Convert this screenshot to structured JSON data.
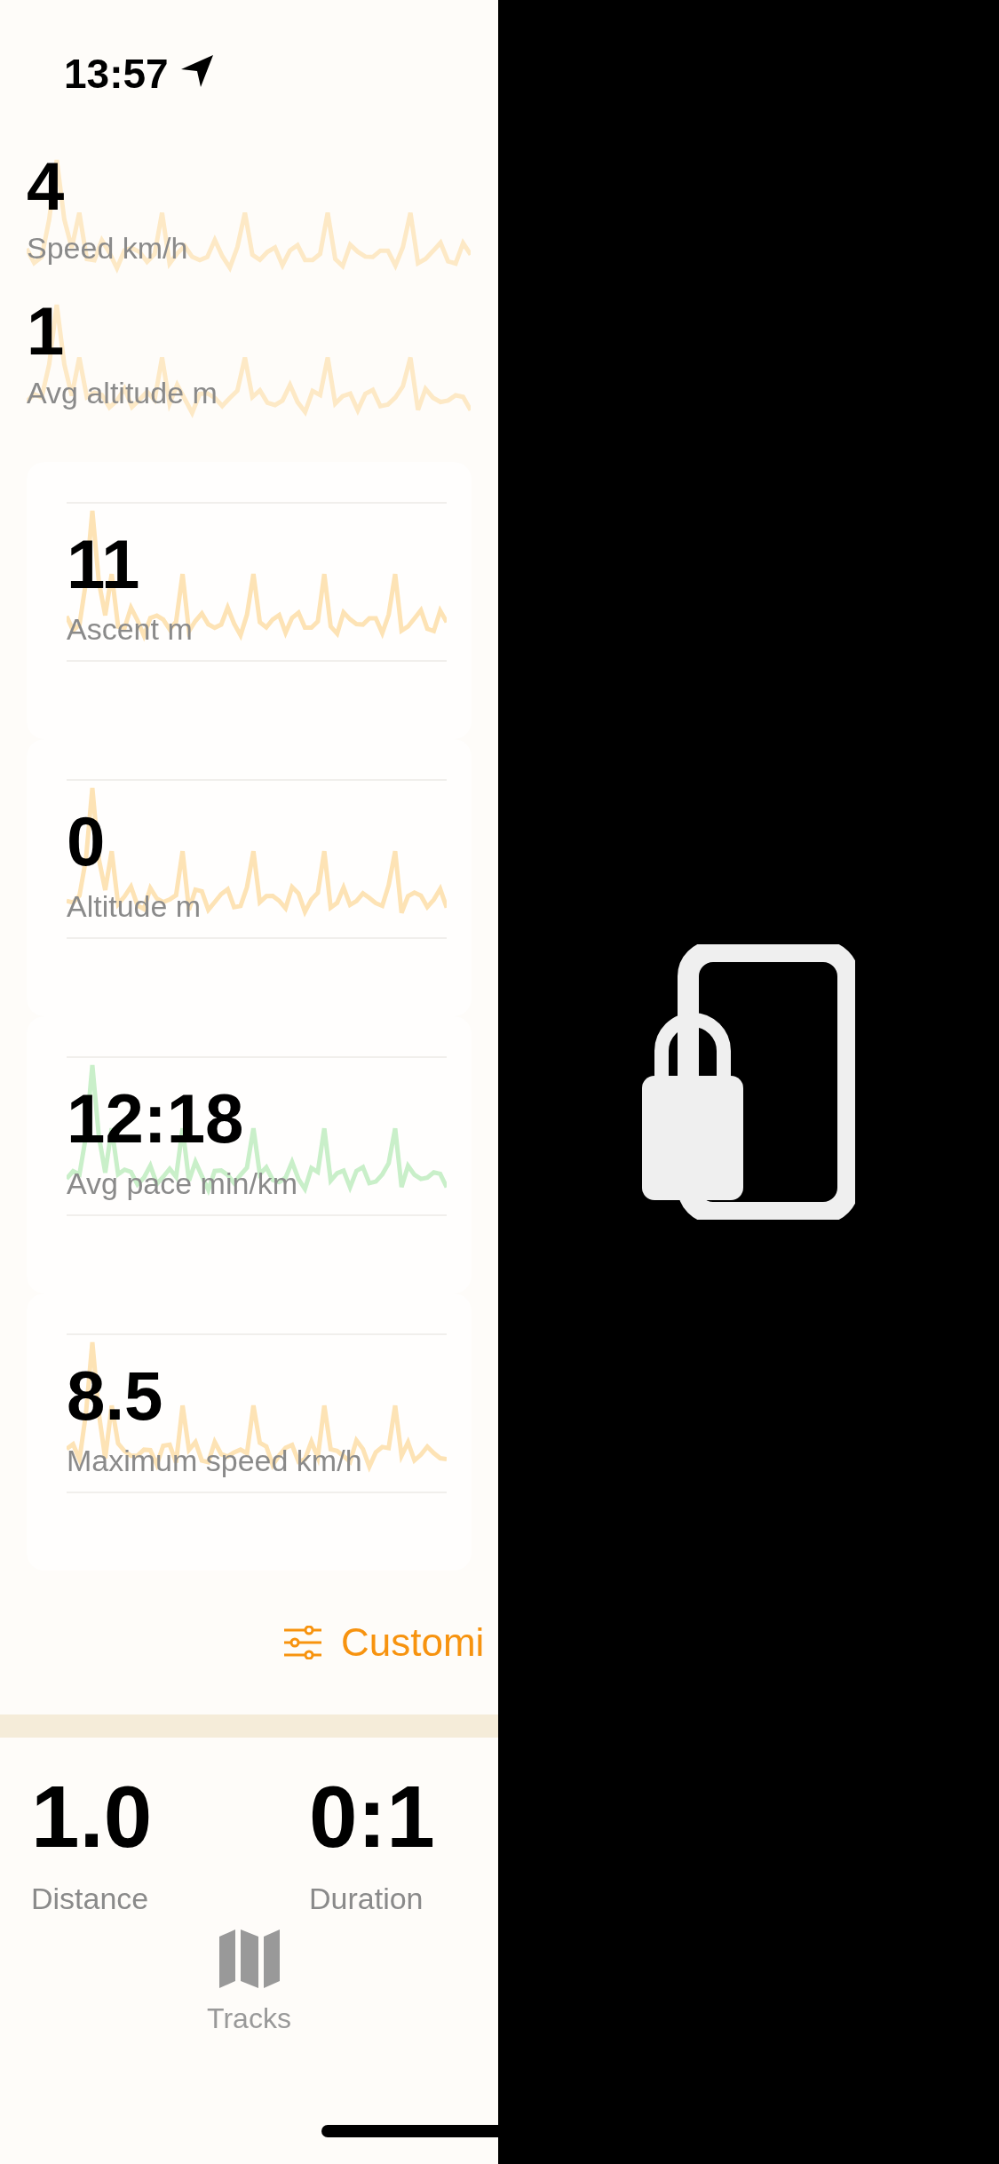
{
  "status_bar": {
    "time": "13:57"
  },
  "top_metrics": [
    {
      "value": "4",
      "label": "Speed km/h"
    },
    {
      "value": "1",
      "label": "Avg altitude m"
    }
  ],
  "cards": [
    {
      "value": "11",
      "label": "Ascent m",
      "color": "#fde3b5"
    },
    {
      "value": "0",
      "label": "Altitude m",
      "color": "#fde3b5"
    },
    {
      "value": "12:18",
      "label": "Avg pace min/km",
      "color": "#c9efc9"
    },
    {
      "value": "8.5",
      "label": "Maximum speed km/h",
      "color": "#fde3b5"
    }
  ],
  "customize_button": {
    "label": "Customi"
  },
  "summary": [
    {
      "value": "1.0",
      "label": "Distance"
    },
    {
      "value": "0:1",
      "label": "Duration"
    }
  ],
  "tab_bar": {
    "tabs": [
      {
        "label": "Tracks"
      }
    ]
  }
}
